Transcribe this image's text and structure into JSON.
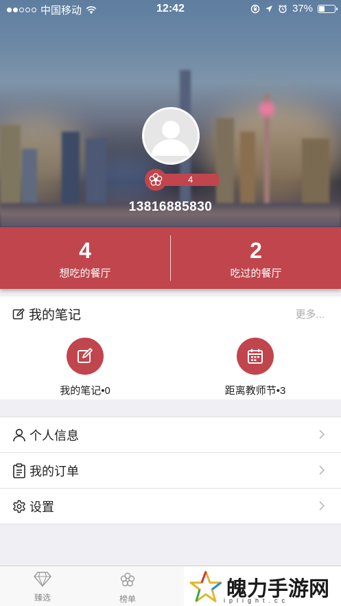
{
  "status_bar": {
    "carrier": "中国移动",
    "time": "12:42",
    "battery": "37%",
    "battery_level": 0.37
  },
  "profile": {
    "level": "4",
    "phone": "13816885830"
  },
  "stats": [
    {
      "value": "4",
      "label": "想吃的餐厅"
    },
    {
      "value": "2",
      "label": "吃过的餐厅"
    }
  ],
  "notes": {
    "title": "我的笔记",
    "more": "更多...",
    "items": [
      {
        "label": "我的笔记•0",
        "icon": "edit-icon"
      },
      {
        "label": "距离教师节•3",
        "icon": "calendar-icon"
      }
    ]
  },
  "menu": [
    {
      "label": "个人信息",
      "icon": "person-icon"
    },
    {
      "label": "我的订单",
      "icon": "clipboard-icon"
    },
    {
      "label": "设置",
      "icon": "gear-icon"
    }
  ],
  "tabbar": {
    "tabs": [
      {
        "label": "臻选",
        "icon": "diamond-icon"
      },
      {
        "label": "榜单",
        "icon": "flower-icon"
      }
    ]
  },
  "watermark": {
    "text": "魄力手游网",
    "sub": "iplight.cc"
  },
  "colors": {
    "accent": "#c1454c",
    "background": "#efeff4"
  }
}
